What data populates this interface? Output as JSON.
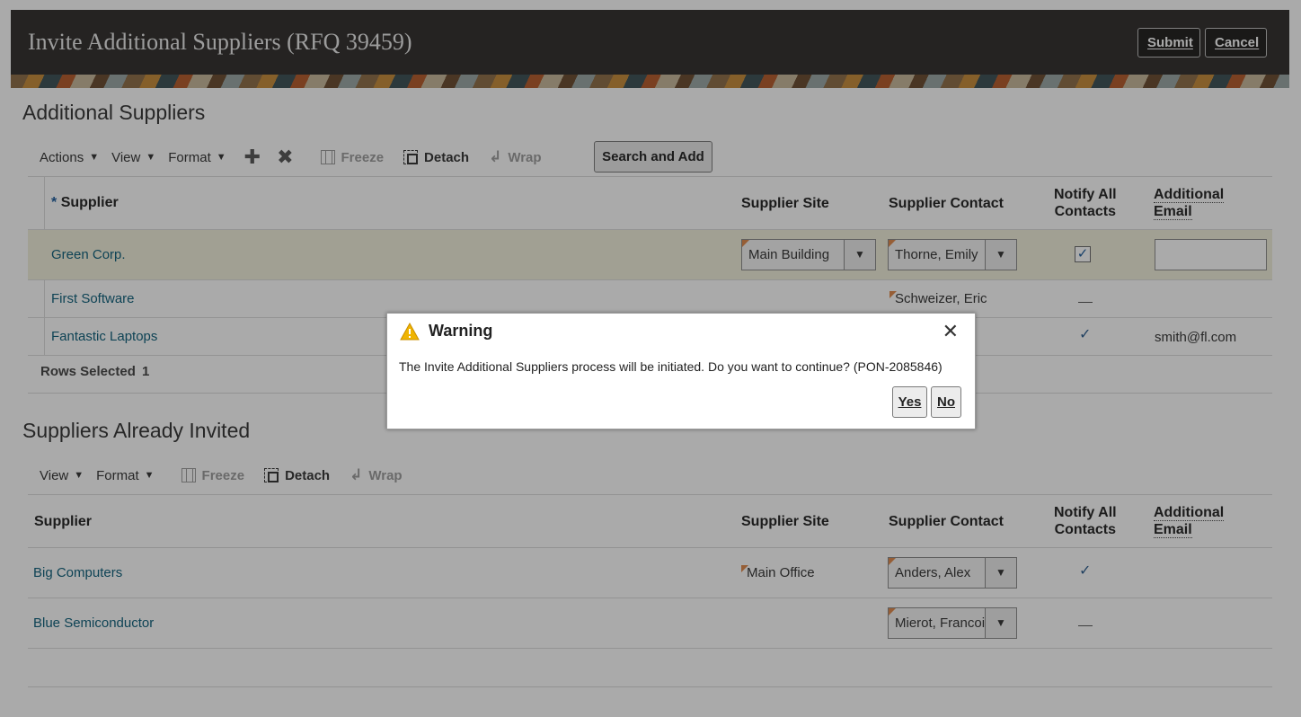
{
  "header": {
    "title": "Invite Additional Suppliers (RFQ 39459)",
    "submit_label": "Submit",
    "cancel_label": "Cancel"
  },
  "additional_suppliers": {
    "title": "Additional Suppliers",
    "toolbar": {
      "actions": "Actions",
      "view": "View",
      "format": "Format",
      "add_icon": "plus-icon",
      "delete_icon": "x-icon",
      "freeze": "Freeze",
      "detach": "Detach",
      "wrap": "Wrap",
      "search_and_add": "Search and Add"
    },
    "columns": {
      "required_marker": "*",
      "supplier": "Supplier",
      "site": "Supplier Site",
      "contact": "Supplier Contact",
      "notify_line1": "Notify All",
      "notify_line2": "Contacts",
      "email_line1": "Additional",
      "email_line2": "Email"
    },
    "rows": [
      {
        "supplier": "Green Corp.",
        "site": "Main Building",
        "contact": "Thorne, Emily",
        "notify": "checked",
        "email": ""
      },
      {
        "supplier": "First Software",
        "site": "",
        "contact": "Schweizer, Eric",
        "notify": "no",
        "email": ""
      },
      {
        "supplier": "Fantastic Laptops",
        "site": "",
        "contact": "",
        "notify": "yes",
        "email": "smith@fl.com"
      }
    ],
    "rows_selected_label": "Rows Selected",
    "rows_selected_count": "1"
  },
  "already_invited": {
    "title": "Suppliers Already Invited",
    "toolbar": {
      "view": "View",
      "format": "Format",
      "freeze": "Freeze",
      "detach": "Detach",
      "wrap": "Wrap"
    },
    "columns": {
      "supplier": "Supplier",
      "site": "Supplier Site",
      "contact": "Supplier Contact",
      "notify_line1": "Notify All",
      "notify_line2": "Contacts",
      "email_line1": "Additional",
      "email_line2": "Email"
    },
    "rows": [
      {
        "supplier": "Big Computers",
        "site": "Main Office",
        "contact": "Anders, Alex",
        "notify": "yes"
      },
      {
        "supplier": "Blue Semiconductor",
        "site": "",
        "contact": "Mierot, Francois",
        "notify": "no"
      }
    ]
  },
  "dialog": {
    "title": "Warning",
    "icon": "warning-icon",
    "message": "The Invite Additional Suppliers process will be initiated. Do you want to continue? (PON-2085846)",
    "yes_label": "Yes",
    "no_label": "No",
    "close_symbol": "✕"
  },
  "symbols": {
    "caret": "▼",
    "check": "✓",
    "plus": "✚",
    "cross": "✖",
    "wrap": "↲"
  },
  "colors": {
    "header_bg": "#2f2d2b",
    "link": "#0b5e7a",
    "selected_row": "#f1f0dc",
    "required_mark": "#e0884a",
    "warning": "#f0b400"
  }
}
